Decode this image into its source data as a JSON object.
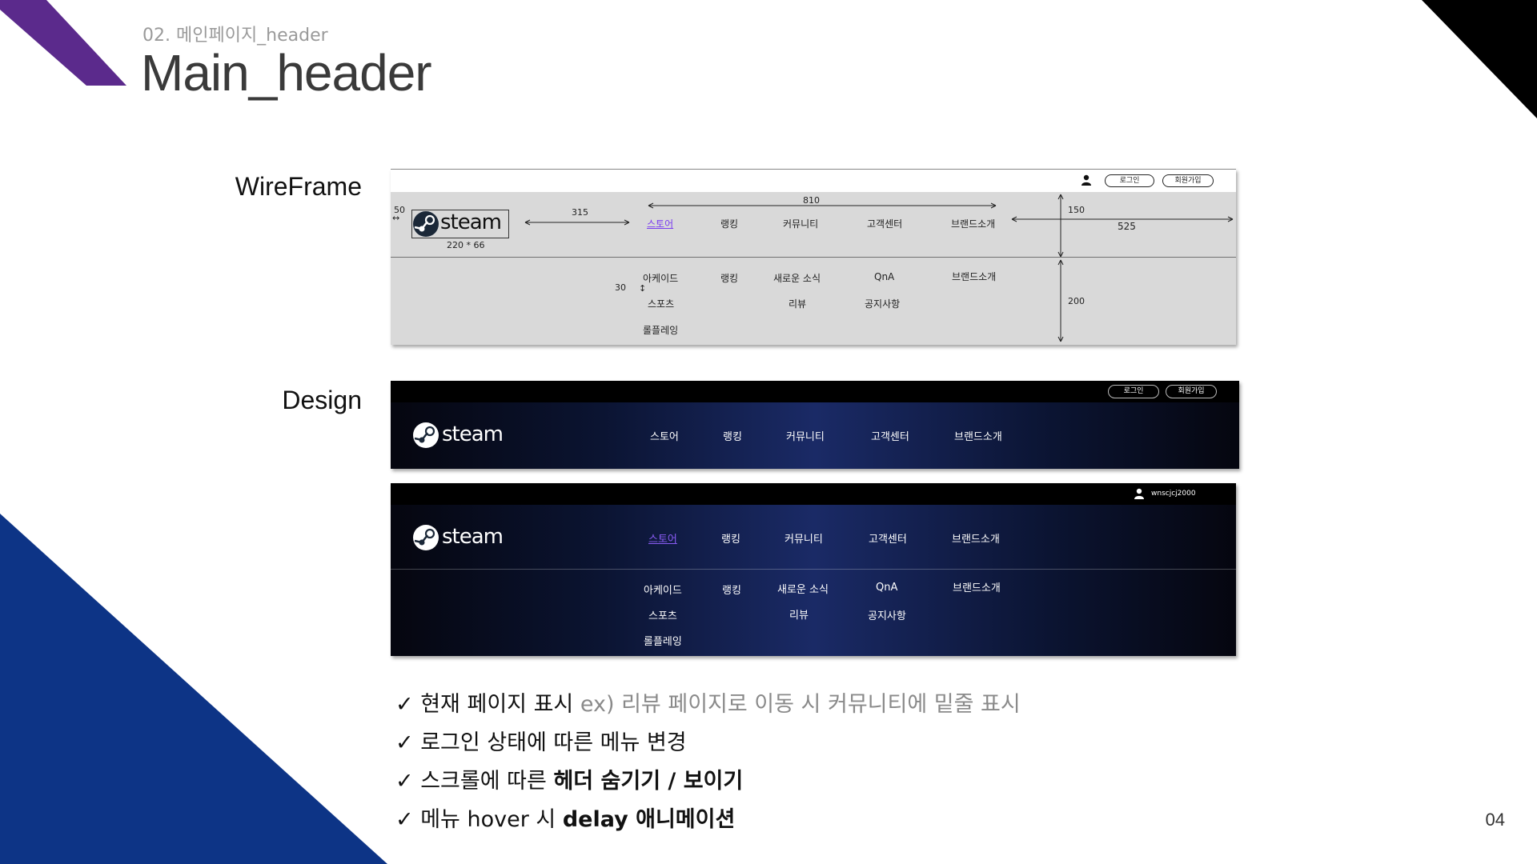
{
  "slide": {
    "subtitle": "02. 메인페이지_header",
    "title": "Main_header",
    "wireframe_label": "WireFrame",
    "design_label": "Design",
    "page_number": "04"
  },
  "wireframe": {
    "login_btn": "로그인",
    "signup_btn": "회원가입",
    "logo_text": "steam",
    "logo_size": "220 * 66",
    "dim_50": "50",
    "dim_315": "315",
    "dim_810": "810",
    "dim_150": "150",
    "dim_525": "525",
    "dim_30": "30",
    "dim_200": "200",
    "nav": [
      "스토어",
      "랭킹",
      "커뮤니티",
      "고객센터",
      "브랜드소개"
    ],
    "sub": {
      "store_1": "아케이드",
      "store_2": "스포츠",
      "store_3": "롤플레잉",
      "ranking_1": "랭킹",
      "community_1": "새로운 소식",
      "community_2": "리뷰",
      "support_1": "QnA",
      "support_2": "공지사항",
      "brand_1": "브랜드소개"
    }
  },
  "design1": {
    "login_btn": "로그인",
    "signup_btn": "회원가입",
    "logo_text": "steam",
    "nav": [
      "스토어",
      "랭킹",
      "커뮤니티",
      "고객센터",
      "브랜드소개"
    ]
  },
  "design2": {
    "username": "wnscjcj2000",
    "logo_text": "steam",
    "nav": [
      "스토어",
      "랭킹",
      "커뮤니티",
      "고객센터",
      "브랜드소개"
    ],
    "sub": {
      "store_1": "아케이드",
      "store_2": "스포츠",
      "store_3": "롤플레잉",
      "ranking_1": "랭킹",
      "community_1": "새로운 소식",
      "community_2": "리뷰",
      "support_1": "QnA",
      "support_2": "공지사항",
      "brand_1": "브랜드소개"
    }
  },
  "notes": {
    "n1_a": "현재 페이지 표시",
    "n1_b": "ex) 리뷰 페이지로 이동 시 커뮤니티에 밑줄 표시",
    "n2_a": "로그인 상태에 따른 메뉴 변경",
    "n3_a": "스크롤에 따른",
    "n3_b": "헤더 숨기기 / 보이기",
    "n4_a": "메뉴 hover 시",
    "n4_b": "delay 애니메이션",
    "check": "✓"
  },
  "colors": {
    "purple_accent": "#5b2a8c",
    "blue_triangle": "#0d3486",
    "black_corner": "#000000",
    "active_nav": "#8a5cf5"
  }
}
